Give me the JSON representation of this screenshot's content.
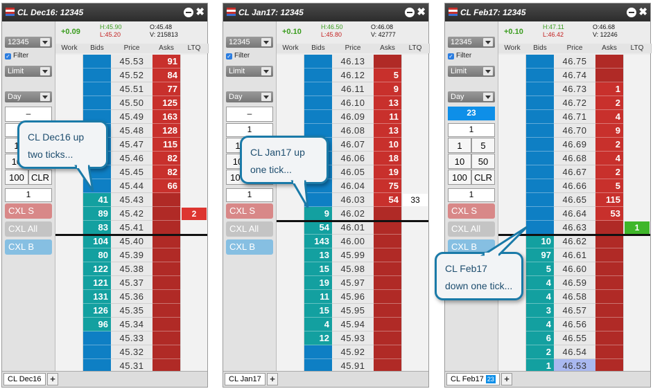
{
  "colors": {
    "bid": "#0e7fc4",
    "bid_filled": "#13a0a0",
    "ask": "#c8302c",
    "ask_dark": "#b02a26",
    "ltq_red": "#dd3530",
    "ltq_green": "#3fb62a",
    "highlight": "#a9b8f0"
  },
  "panels": [
    {
      "title": "CL Dec16: 12345",
      "account": "12345",
      "filter_label": "Filter",
      "order_type": "Limit",
      "tif": "Day",
      "qty_display": "–",
      "qty_top": "",
      "qty_input": "1",
      "qty_buttons": [
        "1",
        "5",
        "10",
        "50",
        "100",
        "CLR"
      ],
      "cxl_s": "CXL S",
      "cxl_all": "CXL All",
      "cxl_b": "CXL B",
      "change": "+0.09",
      "high": "H:45.90",
      "low": "L:45.20",
      "open": "O:45.48",
      "volume": "V: 215813",
      "headers": [
        "Work",
        "Bids",
        "Price",
        "Asks",
        "LTQ"
      ],
      "last_row": 12,
      "ltq_row": 11,
      "ltq_value": "2",
      "ltq_color": "red",
      "rows": [
        {
          "price": "45.53",
          "bid": "",
          "ask": "91"
        },
        {
          "price": "45.52",
          "bid": "",
          "ask": "84"
        },
        {
          "price": "45.51",
          "bid": "",
          "ask": "77"
        },
        {
          "price": "45.50",
          "bid": "",
          "ask": "125"
        },
        {
          "price": "45.49",
          "bid": "",
          "ask": "163"
        },
        {
          "price": "45.48",
          "bid": "",
          "ask": "128"
        },
        {
          "price": "45.47",
          "bid": "",
          "ask": "115"
        },
        {
          "price": "45.46",
          "bid": "",
          "ask": "82"
        },
        {
          "price": "45.45",
          "bid": "",
          "ask": "82"
        },
        {
          "price": "45.44",
          "bid": "",
          "ask": "66"
        },
        {
          "price": "45.43",
          "bid": "41",
          "ask": ""
        },
        {
          "price": "45.42",
          "bid": "89",
          "ask": ""
        },
        {
          "price": "45.41",
          "bid": "83",
          "ask": ""
        },
        {
          "price": "45.40",
          "bid": "104",
          "ask": ""
        },
        {
          "price": "45.39",
          "bid": "80",
          "ask": ""
        },
        {
          "price": "45.38",
          "bid": "122",
          "ask": ""
        },
        {
          "price": "45.37",
          "bid": "121",
          "ask": ""
        },
        {
          "price": "45.36",
          "bid": "131",
          "ask": ""
        },
        {
          "price": "45.35",
          "bid": "126",
          "ask": ""
        },
        {
          "price": "45.34",
          "bid": "96",
          "ask": ""
        },
        {
          "price": "45.33",
          "bid": "",
          "ask": ""
        },
        {
          "price": "45.32",
          "bid": "",
          "ask": ""
        },
        {
          "price": "45.31",
          "bid": "",
          "ask": ""
        }
      ],
      "tab_label": "CL Dec16",
      "tab_badge": "",
      "callout": "CL Dec16 up two ticks..."
    },
    {
      "title": "CL Jan17: 12345",
      "account": "12345",
      "filter_label": "Filter",
      "order_type": "Limit",
      "tif": "Day",
      "qty_display": "–",
      "qty_top": "1",
      "qty_input": "1",
      "qty_buttons": [
        "1",
        "5",
        "10",
        "50",
        "100",
        "CLR"
      ],
      "cxl_s": "CXL S",
      "cxl_all": "CXL All",
      "cxl_b": "CXL B",
      "change": "+0.10",
      "high": "H:46.50",
      "low": "L:45.80",
      "open": "O:46.08",
      "volume": "V: 42777",
      "headers": [
        "Work",
        "Bids",
        "Price",
        "Asks",
        "LTQ"
      ],
      "last_row": 11,
      "ltq_row": 10,
      "ltq_value": "33",
      "ltq_color": "white",
      "rows": [
        {
          "price": "46.13",
          "bid": "",
          "ask": ""
        },
        {
          "price": "46.12",
          "bid": "",
          "ask": "5"
        },
        {
          "price": "46.11",
          "bid": "",
          "ask": "9"
        },
        {
          "price": "46.10",
          "bid": "",
          "ask": "13"
        },
        {
          "price": "46.09",
          "bid": "",
          "ask": "11"
        },
        {
          "price": "46.08",
          "bid": "",
          "ask": "13"
        },
        {
          "price": "46.07",
          "bid": "",
          "ask": "10"
        },
        {
          "price": "46.06",
          "bid": "",
          "ask": "18"
        },
        {
          "price": "46.05",
          "bid": "",
          "ask": "19"
        },
        {
          "price": "46.04",
          "bid": "",
          "ask": "75"
        },
        {
          "price": "46.03",
          "bid": "",
          "ask": "54"
        },
        {
          "price": "46.02",
          "bid": "9",
          "ask": ""
        },
        {
          "price": "46.01",
          "bid": "54",
          "ask": ""
        },
        {
          "price": "46.00",
          "bid": "143",
          "ask": ""
        },
        {
          "price": "45.99",
          "bid": "13",
          "ask": ""
        },
        {
          "price": "45.98",
          "bid": "15",
          "ask": ""
        },
        {
          "price": "45.97",
          "bid": "19",
          "ask": ""
        },
        {
          "price": "45.96",
          "bid": "11",
          "ask": ""
        },
        {
          "price": "45.95",
          "bid": "15",
          "ask": ""
        },
        {
          "price": "45.94",
          "bid": "4",
          "ask": ""
        },
        {
          "price": "45.93",
          "bid": "12",
          "ask": ""
        },
        {
          "price": "45.92",
          "bid": "",
          "ask": ""
        },
        {
          "price": "45.91",
          "bid": "",
          "ask": ""
        }
      ],
      "tab_label": "CL Jan17",
      "tab_badge": "",
      "callout": "CL Jan17 up one tick..."
    },
    {
      "title": "CL Feb17: 12345",
      "account": "12345",
      "filter_label": "Filter",
      "order_type": "Limit",
      "tif": "Day",
      "qty_display": "23",
      "qty_top": "1",
      "qty_input": "1",
      "qty_buttons": [
        "1",
        "5",
        "10",
        "50",
        "100",
        "CLR"
      ],
      "cxl_s": "CXL S",
      "cxl_all": "CXL All",
      "cxl_b": "CXL B",
      "change": "+0.10",
      "high": "H:47.11",
      "low": "L:46.42",
      "open": "O:46.68",
      "volume": "V: 12246",
      "headers": [
        "Work",
        "Bids",
        "Price",
        "Asks",
        "LTQ"
      ],
      "last_row": 12,
      "ltq_row": 12,
      "ltq_value": "1",
      "ltq_color": "green",
      "highlight_row": 22,
      "rows": [
        {
          "price": "46.75",
          "bid": "",
          "ask": ""
        },
        {
          "price": "46.74",
          "bid": "",
          "ask": ""
        },
        {
          "price": "46.73",
          "bid": "",
          "ask": "1"
        },
        {
          "price": "46.72",
          "bid": "",
          "ask": "2"
        },
        {
          "price": "46.71",
          "bid": "",
          "ask": "4"
        },
        {
          "price": "46.70",
          "bid": "",
          "ask": "9"
        },
        {
          "price": "46.69",
          "bid": "",
          "ask": "2"
        },
        {
          "price": "46.68",
          "bid": "",
          "ask": "4"
        },
        {
          "price": "46.67",
          "bid": "",
          "ask": "2"
        },
        {
          "price": "46.66",
          "bid": "",
          "ask": "5"
        },
        {
          "price": "46.65",
          "bid": "",
          "ask": "115"
        },
        {
          "price": "46.64",
          "bid": "",
          "ask": "53"
        },
        {
          "price": "46.63",
          "bid": "",
          "ask": ""
        },
        {
          "price": "46.62",
          "bid": "10",
          "ask": ""
        },
        {
          "price": "46.61",
          "bid": "97",
          "ask": ""
        },
        {
          "price": "46.60",
          "bid": "5",
          "ask": ""
        },
        {
          "price": "46.59",
          "bid": "4",
          "ask": ""
        },
        {
          "price": "46.58",
          "bid": "4",
          "ask": ""
        },
        {
          "price": "46.57",
          "bid": "3",
          "ask": ""
        },
        {
          "price": "46.56",
          "bid": "4",
          "ask": ""
        },
        {
          "price": "46.55",
          "bid": "6",
          "ask": ""
        },
        {
          "price": "46.54",
          "bid": "2",
          "ask": ""
        },
        {
          "price": "46.53",
          "bid": "1",
          "ask": ""
        }
      ],
      "tab_label": "CL Feb17",
      "tab_badge": "23",
      "callout": "CL Feb17 down one tick..."
    }
  ]
}
